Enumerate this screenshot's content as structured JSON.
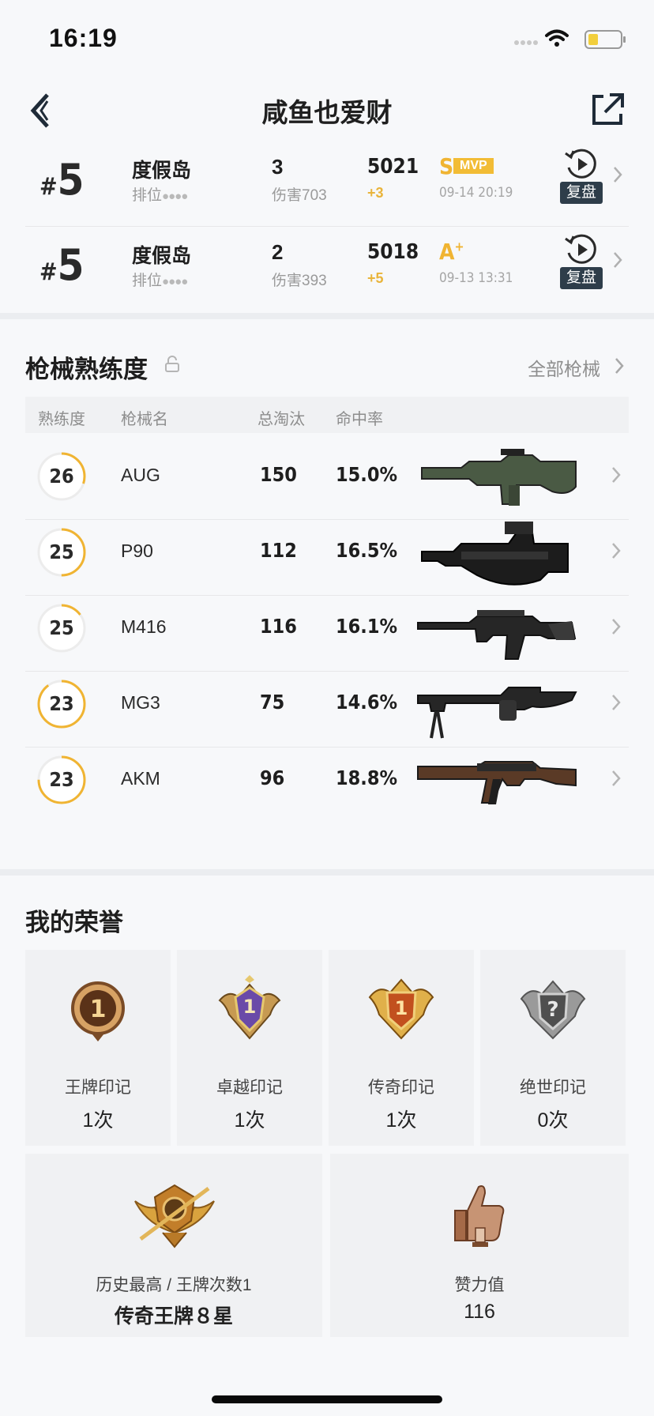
{
  "status_bar": {
    "time": "16:19"
  },
  "header": {
    "title": "咸鱼也爱财"
  },
  "matches": [
    {
      "rank_hash": "#",
      "rank": "5",
      "map": "度假岛",
      "mode": "排位",
      "kills": "3",
      "damage": "伤害703",
      "rating": "5021",
      "delta": "+3",
      "grade": "S",
      "grade_sup": "",
      "mvp": "MVP",
      "date": "09-14 20:19",
      "replay": "复盘"
    },
    {
      "rank_hash": "#",
      "rank": "5",
      "map": "度假岛",
      "mode": "排位",
      "kills": "2",
      "damage": "伤害393",
      "rating": "5018",
      "delta": "+5",
      "grade": "A",
      "grade_sup": "+",
      "mvp": "",
      "date": "09-13 13:31",
      "replay": "复盘"
    }
  ],
  "weapons": {
    "title": "枪械熟练度",
    "all_link": "全部枪械",
    "headers": {
      "proficiency": "熟练度",
      "name": "枪械名",
      "kills": "总淘汰",
      "accuracy": "命中率"
    },
    "rows": [
      {
        "level": "26",
        "progress": 0.3,
        "name": "AUG",
        "kills": "150",
        "accuracy": "15.0%",
        "icon": "aug-rifle"
      },
      {
        "level": "25",
        "progress": 0.5,
        "name": "P90",
        "kills": "112",
        "accuracy": "16.5%",
        "icon": "p90-smg"
      },
      {
        "level": "25",
        "progress": 0.15,
        "name": "M416",
        "kills": "116",
        "accuracy": "16.1%",
        "icon": "m416-rifle"
      },
      {
        "level": "23",
        "progress": 0.9,
        "name": "MG3",
        "kills": "75",
        "accuracy": "14.6%",
        "icon": "mg3-machine-gun"
      },
      {
        "level": "23",
        "progress": 0.75,
        "name": "AKM",
        "kills": "96",
        "accuracy": "18.8%",
        "icon": "akm-rifle"
      }
    ]
  },
  "honors": {
    "title": "我的荣誉",
    "badges": [
      {
        "name": "王牌印记",
        "count": "1次",
        "icon": "ace-medal"
      },
      {
        "name": "卓越印记",
        "count": "1次",
        "icon": "excellence-badge"
      },
      {
        "name": "传奇印记",
        "count": "1次",
        "icon": "legend-badge"
      },
      {
        "name": "绝世印记",
        "count": "0次",
        "icon": "unmatched-badge-locked"
      }
    ],
    "highest": {
      "label": "历史最高 / 王牌次数1",
      "value": "传奇王牌８星",
      "icon": "legendary-ace-emblem"
    },
    "likes": {
      "label": "赞力值",
      "value": "116",
      "icon": "thumbs-up-trophy"
    }
  },
  "colors": {
    "accent_gold": "#f0b432",
    "ring_track": "#ececec",
    "replay_bg": "#2e3d4a"
  }
}
